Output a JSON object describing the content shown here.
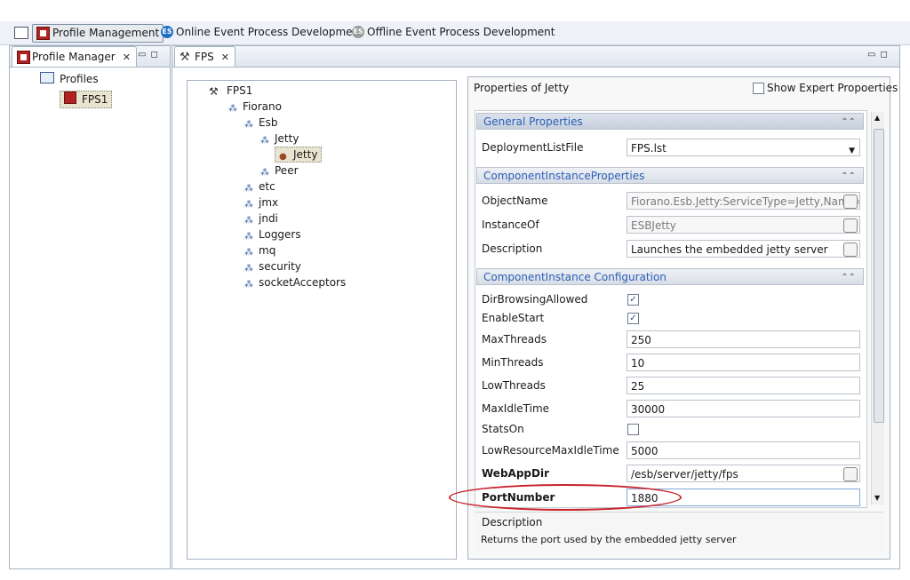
{
  "perspectives": {
    "active": "Profile Management",
    "items": [
      "Online Event Process Development",
      "Offline Event Process Development"
    ],
    "es_badge": "ES"
  },
  "left_view": {
    "tab": "Profile Manager",
    "tree": {
      "root": "Profiles",
      "child": "FPS1"
    }
  },
  "editor": {
    "tab": "FPS",
    "tree": {
      "root": "FPS1",
      "items": [
        {
          "label": "Fiorano",
          "level": 1
        },
        {
          "label": "Esb",
          "level": 2
        },
        {
          "label": "Jetty",
          "level": 3
        },
        {
          "label": "Jetty",
          "level": 4,
          "selected": true
        },
        {
          "label": "Peer",
          "level": 3
        },
        {
          "label": "etc",
          "level": 2
        },
        {
          "label": "jmx",
          "level": 2
        },
        {
          "label": "jndi",
          "level": 2
        },
        {
          "label": "Loggers",
          "level": 2
        },
        {
          "label": "mq",
          "level": 2
        },
        {
          "label": "security",
          "level": 2
        },
        {
          "label": "socketAcceptors",
          "level": 2
        }
      ]
    }
  },
  "properties": {
    "title": "Properties of Jetty",
    "show_expert": "Show Expert Propoerties",
    "sections": {
      "general": "General Properties",
      "component": "ComponentInstanceProperties",
      "config": "ComponentInstance Configuration"
    },
    "deployment": {
      "label": "DeploymentListFile",
      "value": "FPS.lst"
    },
    "object_name": {
      "label": "ObjectName",
      "value": "Fiorano.Esb.Jetty:ServiceType=Jetty,Name=Je"
    },
    "instance_of": {
      "label": "InstanceOf",
      "value": "ESBJetty"
    },
    "description_row": {
      "label": "Description",
      "value": "Launches the embedded jetty server"
    },
    "dir_browsing": {
      "label": "DirBrowsingAllowed",
      "checked": true
    },
    "enable_start": {
      "label": "EnableStart",
      "checked": true
    },
    "max_threads": {
      "label": "MaxThreads",
      "value": "250"
    },
    "min_threads": {
      "label": "MinThreads",
      "value": "10"
    },
    "low_threads": {
      "label": "LowThreads",
      "value": "25"
    },
    "max_idle": {
      "label": "MaxIdleTime",
      "value": "30000"
    },
    "stats_on": {
      "label": "StatsOn",
      "checked": false
    },
    "low_resource": {
      "label": "LowResourceMaxIdleTime",
      "value": "5000"
    },
    "webapp_dir": {
      "label": "WebAppDir",
      "value": "/esb/server/jetty/fps"
    },
    "port_number": {
      "label": "PortNumber",
      "value": "1880"
    },
    "desc_box": {
      "title": "Description",
      "text": "Returns the port used by the embedded jetty server"
    }
  },
  "colors": {
    "accent": "#2b5fb8",
    "highlight": "#c8232c",
    "selection": "#e8e4cf"
  }
}
